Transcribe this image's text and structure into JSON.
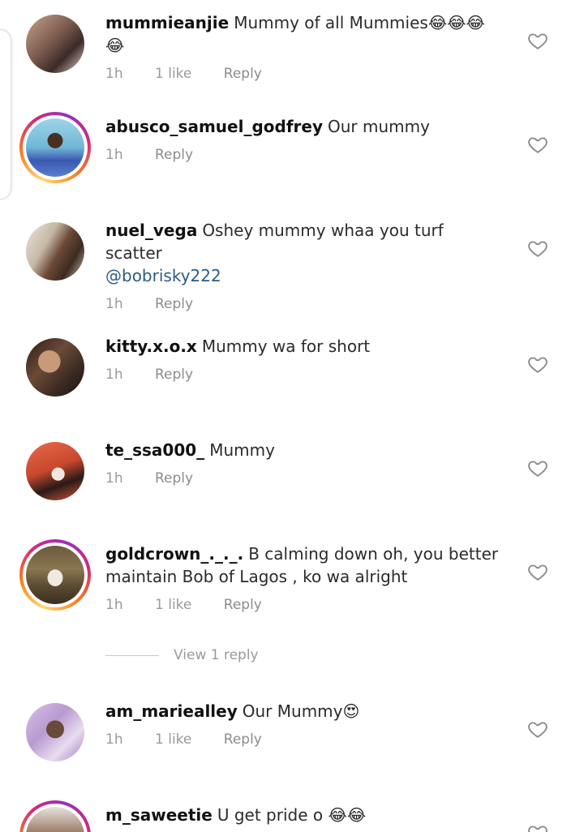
{
  "comments": [
    {
      "username": "mummieanjie",
      "text": "Mummy of all Mummies😂😂😂😂",
      "time": "1h",
      "likes": "1 like",
      "reply": "Reply"
    },
    {
      "username": "abusco_samuel_godfrey",
      "text": "Our mummy",
      "time": "1h",
      "reply": "Reply"
    },
    {
      "username": "nuel_vega",
      "text": "Oshey mummy whaa you turf scatter",
      "mention": "@bobrisky222",
      "time": "1h",
      "reply": "Reply"
    },
    {
      "username": "kitty.x.o.x",
      "text": "Mummy wa for short",
      "time": "1h",
      "reply": "Reply"
    },
    {
      "username": "te_ssa000_",
      "text": "Mummy",
      "time": "1h",
      "reply": "Reply"
    },
    {
      "username": "goldcrown_._._.",
      "text": "B calming down oh, you better maintain Bob of Lagos , ko wa alright",
      "time": "1h",
      "likes": "1 like",
      "reply": "Reply"
    },
    {
      "username": "am_mariealley",
      "text": "Our Mummy😍",
      "time": "1h",
      "likes": "1 like",
      "reply": "Reply"
    },
    {
      "username": "m_saweetie",
      "text": "U get pride o 😂😂"
    }
  ],
  "view_replies": "View 1 reply",
  "icons": {
    "like": "heart-outline-icon"
  },
  "colors": {
    "mention": "#2d5a87",
    "meta": "#9a9a9a"
  }
}
